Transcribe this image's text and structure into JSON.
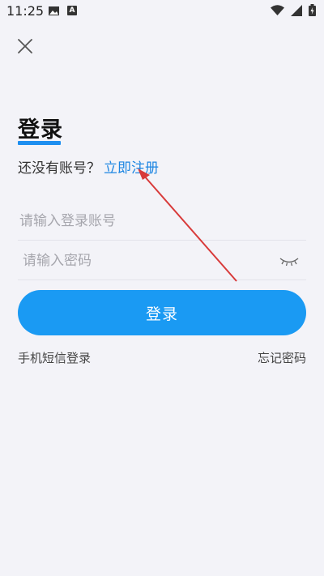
{
  "status_bar": {
    "time": "11:25",
    "icons": [
      "image-icon",
      "a-notification-icon",
      "wifi-icon",
      "signal-icon",
      "battery-icon"
    ]
  },
  "header": {
    "close_icon": "close-icon"
  },
  "login": {
    "title": "登录",
    "register_prompt": "还没有账号？",
    "register_link": "立即注册",
    "account_placeholder": "请输入登录账号",
    "password_placeholder": "请输入密码",
    "password_visibility_icon": "eye-closed-icon",
    "submit_label": "登录",
    "sms_login": "手机短信登录",
    "forgot_password": "忘记密码"
  },
  "colors": {
    "accent": "#1a9af3",
    "link": "#1d86e2",
    "background": "#f3f3f8",
    "annotation_arrow": "#d83a3a"
  }
}
